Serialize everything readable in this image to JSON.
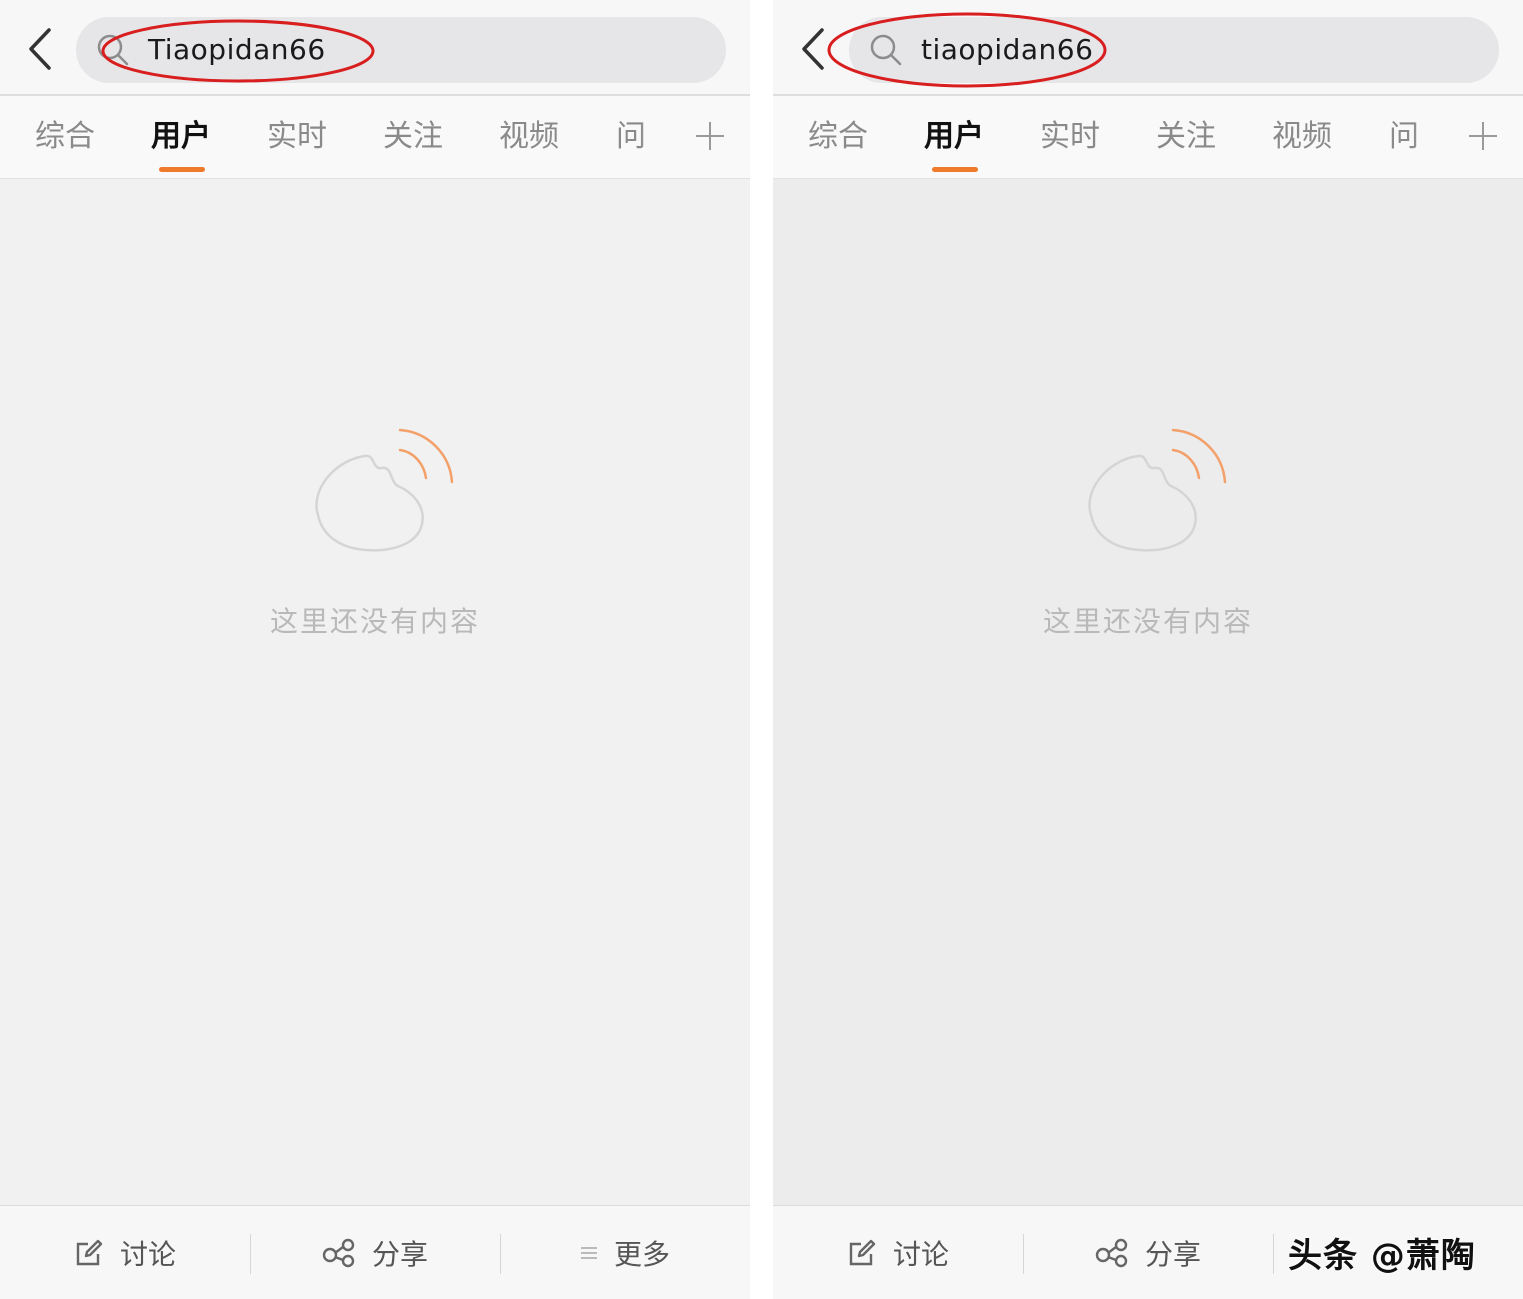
{
  "panels": [
    {
      "search_query": "Tiaopidan66",
      "tabs": [
        "综合",
        "用户",
        "实时",
        "关注",
        "视频",
        "问答"
      ],
      "active_tab": "用户",
      "empty_message": "这里还没有内容",
      "bottom": {
        "discuss_label": "讨论",
        "share_label": "分享",
        "more_label": "更多"
      }
    },
    {
      "search_query": "tiaopidan66",
      "tabs": [
        "综合",
        "用户",
        "实时",
        "关注",
        "视频",
        "问答"
      ],
      "active_tab": "用户",
      "empty_message": "这里还没有内容",
      "bottom": {
        "discuss_label": "讨论",
        "share_label": "分享"
      },
      "watermark": "头条 @萧陶"
    }
  ],
  "colors": {
    "accent_underline": "#f07a2c",
    "annotation_ellipse": "#d81e1e",
    "empty_icon_waves": "#f3a06a"
  }
}
